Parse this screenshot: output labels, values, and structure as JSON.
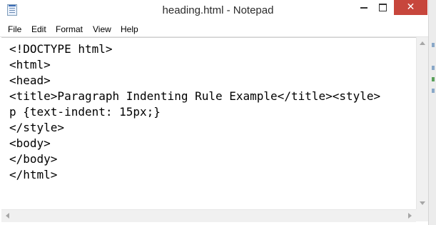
{
  "window": {
    "title": "heading.html - Notepad",
    "close_glyph": "✕"
  },
  "menu": {
    "items": [
      "File",
      "Edit",
      "Format",
      "View",
      "Help"
    ]
  },
  "editor": {
    "lines": [
      "<!DOCTYPE html>",
      "<html>",
      "<head>",
      "<title>Paragraph Indenting Rule Example</title><style>",
      "p {text-indent: 15px;}",
      "</style>",
      "<body>",
      "</body>",
      "</html>"
    ]
  },
  "colors": {
    "close_button": "#c7463c",
    "editor_background": "#ffffff",
    "chrome": "#f0f0f0"
  },
  "icons": [
    "notepad-icon",
    "minimize-icon",
    "maximize-icon",
    "close-icon",
    "scroll-up-icon",
    "scroll-down-icon",
    "scroll-left-icon",
    "scroll-right-icon"
  ]
}
